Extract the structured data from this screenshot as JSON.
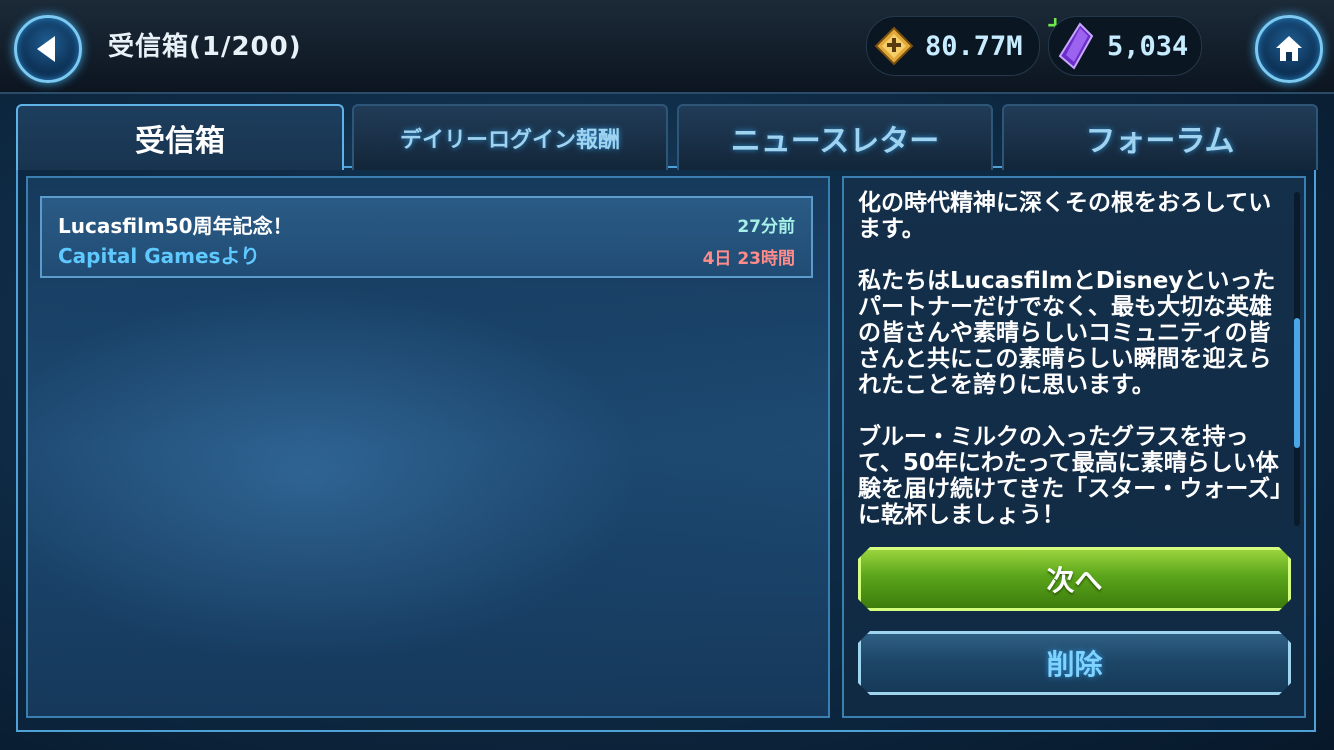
{
  "header": {
    "title": "受信箱(1/200)",
    "credits": "80.77M",
    "crystals": "5,034",
    "back_icon": "back-arrow-icon",
    "home_icon": "home-icon",
    "credits_icon": "credits-icon",
    "crystals_icon": "crystal-icon",
    "add_icon": "plus"
  },
  "tabs": [
    {
      "label": "受信箱",
      "active": true
    },
    {
      "label": "デイリーログイン報酬",
      "active": false
    },
    {
      "label": "ニュースレター",
      "active": false
    },
    {
      "label": "フォーラム",
      "active": false
    }
  ],
  "mail": {
    "items": [
      {
        "subject": "Lucasfilm50周年記念！",
        "sender": "Capital Gamesより",
        "received": "27分前",
        "expires": "4日 23時間"
      }
    ]
  },
  "message": {
    "body": "化の時代精神に深くその根をおろしています。\n\n私たちはLucasfilmとDisneyといったパートナーだけでなく、最も大切な英雄の皆さんや素晴らしいコミュニティの皆さんと共にこの素晴らしい瞬間を迎えられたことを誇りに思います。\n\nブルー・ミルクの入ったグラスを持って、50年にわたって最高に素晴らしい体験を届け続けてきた「スター・ウォーズ」に乾杯しましょう！"
  },
  "buttons": {
    "next": "次へ",
    "delete": "削除"
  },
  "colors": {
    "accent": "#4fa2d8",
    "next_button": "#6ab426",
    "expire_text": "#ff8b8b",
    "sender_text": "#5fc9ff"
  }
}
